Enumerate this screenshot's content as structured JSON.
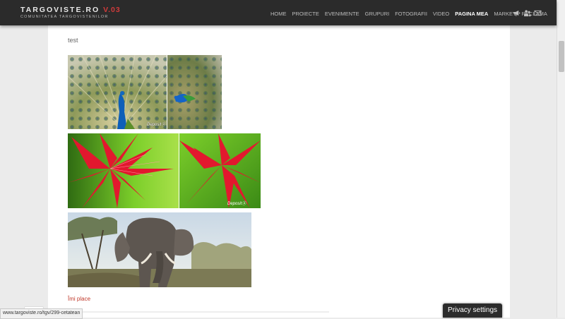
{
  "header": {
    "logo": {
      "name": "TARGOVISTE.RO",
      "version": "V.03",
      "tagline": "COMUNITATEA TARGOVISTENILOR"
    },
    "nav": [
      "HOME",
      "PROIECTE",
      "EVENIMENTE",
      "GRUPURI",
      "FOTOGRAFII",
      "VIDEO",
      "PAGINA MEA",
      "MARKET",
      "RECLAMA"
    ],
    "active_nav": "PAGINA MEA",
    "icons": [
      "megaphone-icon",
      "users-icon",
      "mail-icon"
    ]
  },
  "post": {
    "title": "test",
    "photos": [
      {
        "subject": "peacock",
        "watermark": "Depositⓐ"
      },
      {
        "subject": "peacock"
      },
      {
        "subject": "red-flower"
      },
      {
        "subject": "red-flower",
        "watermark": "Depositⓐ"
      },
      {
        "subject": "elephant"
      }
    ],
    "like_label": "Îmi place"
  },
  "status_url": "www.targoviste.ro/tgv/299-cetatean",
  "privacy_label": "Privacy settings",
  "colors": {
    "header": "#2b2b2b",
    "accent": "#d03b3b",
    "like": "#c0392b"
  }
}
